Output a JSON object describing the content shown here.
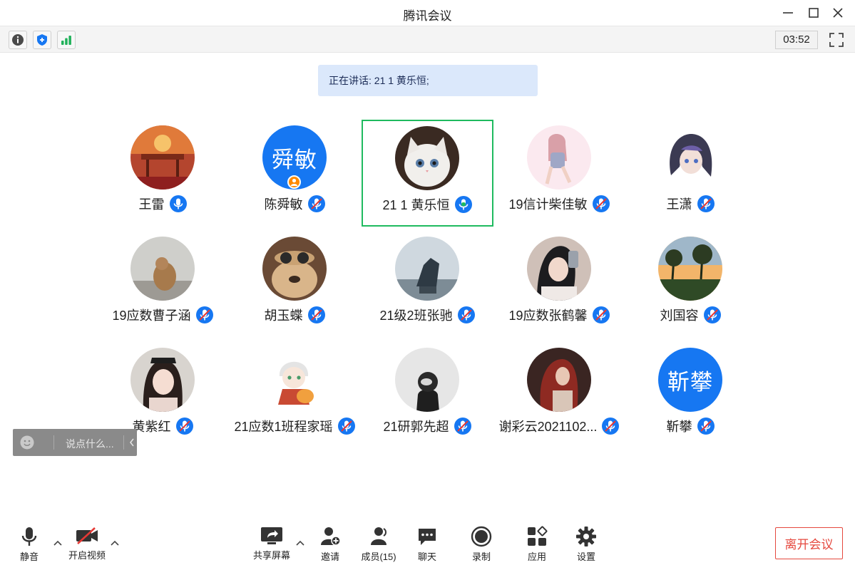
{
  "window": {
    "title": "腾讯会议"
  },
  "infobar": {
    "timer": "03:52"
  },
  "speaking": {
    "text": "正在讲话: 21 1 黄乐恒;"
  },
  "participants": [
    {
      "name": "王雷",
      "avatar": "photo-restaurant"
    },
    {
      "name": "陈舜敏",
      "avatar_text": "舜敏",
      "is_host": true
    },
    {
      "name": "21 1 黄乐恒",
      "avatar": "photo-white-kitten",
      "speaking": true
    },
    {
      "name": "19信计柴佳敏",
      "avatar": "illustration-girl-sitting"
    },
    {
      "name": "王潇",
      "avatar": "illustration-anime-girl"
    },
    {
      "name": "19应数曹子涵",
      "avatar": "photo-capybara"
    },
    {
      "name": "胡玉蝶",
      "avatar": "photo-dog-goggles"
    },
    {
      "name": "21级2班张驰",
      "avatar": "photo-equestrian-statue"
    },
    {
      "name": "19应数张鹤馨",
      "avatar": "photo-woman-selfie"
    },
    {
      "name": "刘国容",
      "avatar": "photo-sunset-trees"
    },
    {
      "name": "黄紫红",
      "avatar": "photo-smiling-woman"
    },
    {
      "name": "21应数1班程家瑶",
      "avatar": "illustration-boy-tiger"
    },
    {
      "name": "21研郭先超",
      "avatar": "photo-astronaut-helmet"
    },
    {
      "name": "谢彩云2021102...",
      "avatar": "photo-woman-red-hair"
    },
    {
      "name": "靳攀",
      "avatar_text": "靳攀"
    }
  ],
  "chat": {
    "placeholder": "说点什么..."
  },
  "toolbar": {
    "mute": "静音",
    "video": "开启视频",
    "share": "共享屏幕",
    "invite": "邀请",
    "members": "成员(15)",
    "chat": "聊天",
    "record": "录制",
    "apps": "应用",
    "settings": "设置",
    "leave": "离开会议"
  },
  "colors": {
    "accent": "#1677f2",
    "speaking_border": "#1fba5f",
    "leave": "#e5483e"
  }
}
